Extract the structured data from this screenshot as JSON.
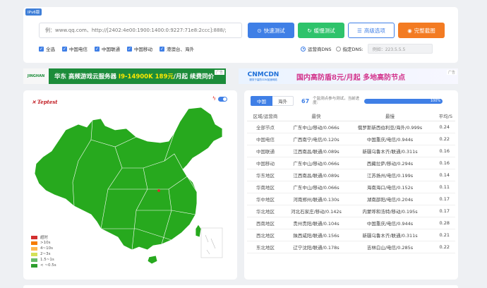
{
  "toolbar": {
    "ipv6_tag": "IPv6版",
    "url_placeholder": "例：www.qq.com、http://[2402:4e00:1900:1400:0:9227:71e8:2ccc]:888/;",
    "btn_fast": "快速测试",
    "btn_slow": "缓慢测试",
    "btn_advanced": "高级选项",
    "btn_full": "完整截图",
    "checks": [
      "全选",
      "中国电信",
      "中国联通",
      "中国移动",
      "港澳台、海外"
    ],
    "dns_local": "运营商DNS",
    "dns_custom": "指定DNS:",
    "dns_placeholder": "例如：223.5.5.5"
  },
  "banners": {
    "left_logo": "JINGHAN",
    "left_pre": "华东 高频游戏云服务器 ",
    "left_price": "I9-14900K 189元",
    "left_post": "/月起 续费同价",
    "right_logo": "CNMCDN",
    "right_logo_sub": "服务于高防CDN加速网络",
    "right_text": "国内高防盾8元/月起 多地高防节点",
    "ad_mark": "广告"
  },
  "map": {
    "logo": "Teptest",
    "legend": [
      {
        "label": "超时",
        "color": "#d32f2f"
      },
      {
        "label": ">10s",
        "color": "#f57c00"
      },
      {
        "label": "4~10s",
        "color": "#ffb74d"
      },
      {
        "label": "2~3s",
        "color": "#d4e157"
      },
      {
        "label": "1.5~1s",
        "color": "#66bb6a"
      },
      {
        "label": "< ~0.5s",
        "color": "#2e9e2e"
      }
    ],
    "region_color": "#27a91e"
  },
  "results": {
    "tab_domestic": "中国",
    "tab_overseas": "海外",
    "count": "67",
    "count_label": "个监测点参与测试，当前进度:",
    "progress_text": "100%",
    "progress": 1.0,
    "headers": [
      "区域/运营商",
      "最快",
      "最慢",
      "平均/S"
    ],
    "rows": [
      {
        "region": "全部节点",
        "fast": "广东中山/移动/0.066s",
        "slow": "俄罗斯新西伯利亚/海外/0.999s",
        "avg": "0.24"
      },
      {
        "region": "中国电信",
        "fast": "广西南宁/电信/0.120s",
        "slow": "中国重庆/电信/0.944s",
        "avg": "0.22"
      },
      {
        "region": "中国联通",
        "fast": "江西南昌/联通/0.089s",
        "slow": "新疆乌鲁木齐/联通/0.311s",
        "avg": "0.16"
      },
      {
        "region": "中国移动",
        "fast": "广东中山/移动/0.066s",
        "slow": "西藏拉萨/移动/0.294s",
        "avg": "0.16"
      },
      {
        "region": "华东地区",
        "fast": "江西南昌/联通/0.089s",
        "slow": "江苏扬州/电信/0.199s",
        "avg": "0.14"
      },
      {
        "region": "华南地区",
        "fast": "广东中山/移动/0.066s",
        "slow": "海南海口/电信/0.152s",
        "avg": "0.11"
      },
      {
        "region": "华中地区",
        "fast": "河南郑州/联通/0.130s",
        "slow": "湖南邵阳/电信/0.204s",
        "avg": "0.17"
      },
      {
        "region": "华北地区",
        "fast": "河北石家庄/移动/0.142s",
        "slow": "内蒙呼和浩特/移动/0.195s",
        "avg": "0.17"
      },
      {
        "region": "西南地区",
        "fast": "贵州贵阳/联通/0.104s",
        "slow": "中国重庆/电信/0.944s",
        "avg": "0.28"
      },
      {
        "region": "西北地区",
        "fast": "陕西咸阳/联通/0.156s",
        "slow": "新疆乌鲁木齐/联通/0.311s",
        "avg": "0.21"
      },
      {
        "region": "东北地区",
        "fast": "辽宁沈阳/联通/0.178s",
        "slow": "吉林白山/电信/0.285s",
        "avg": "0.22"
      }
    ]
  }
}
